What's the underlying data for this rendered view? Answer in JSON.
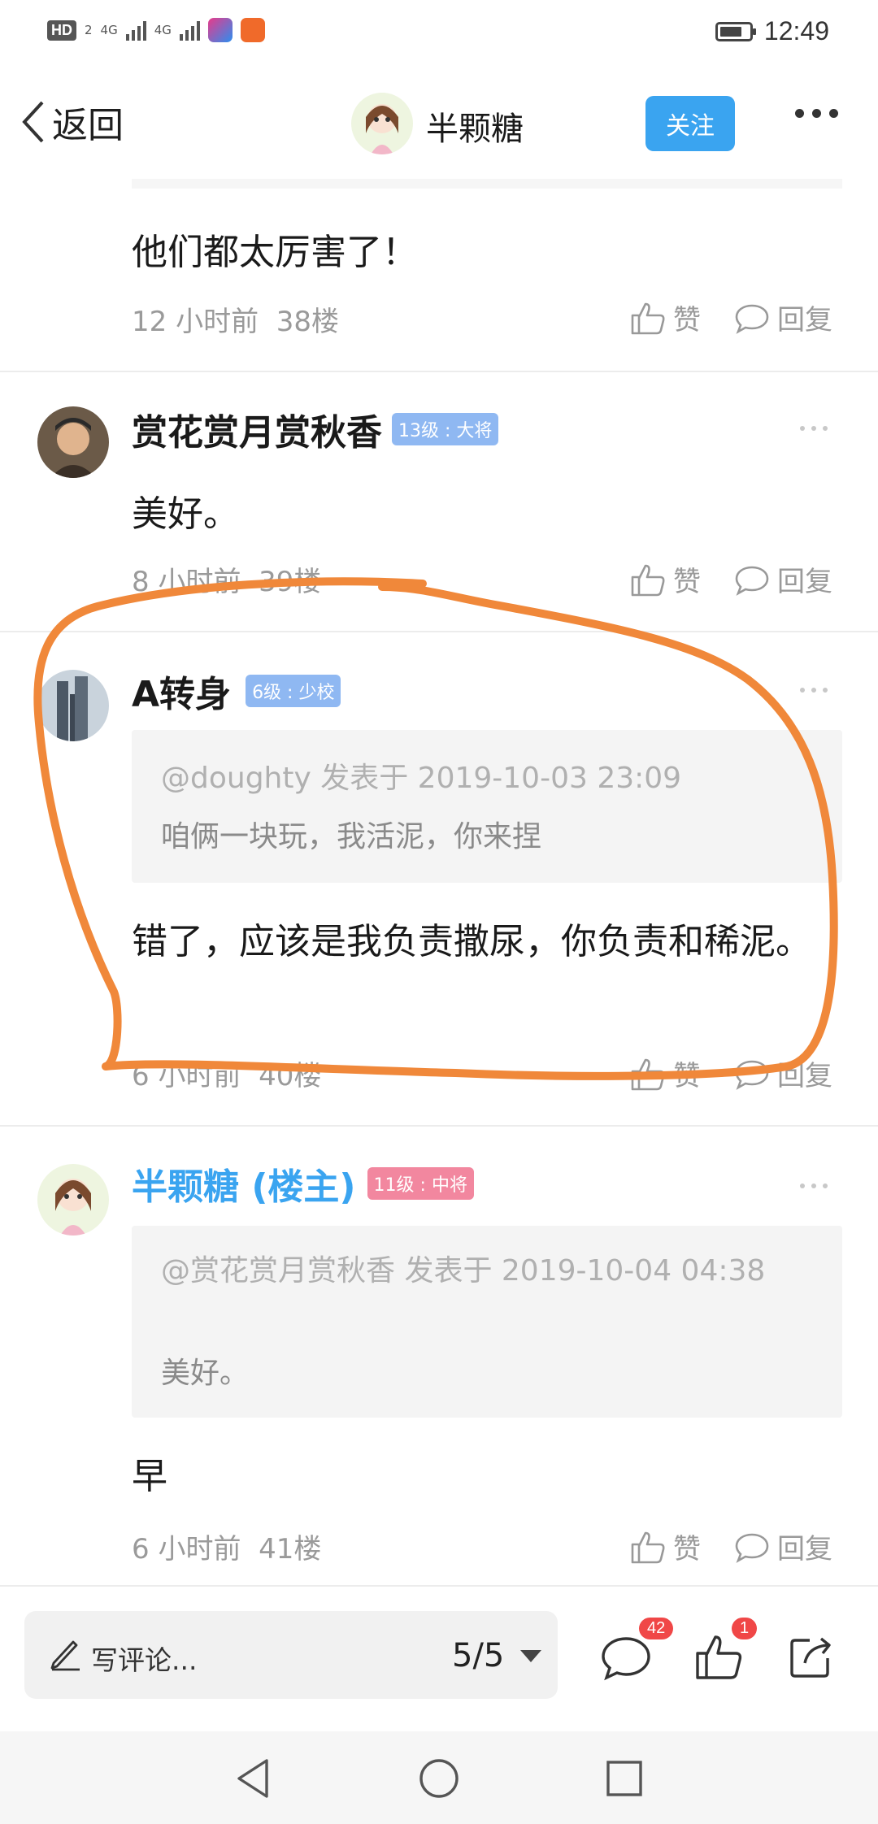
{
  "status_bar": {
    "hd": "HD",
    "hd_sub": "2",
    "net1": "4G",
    "net2": "4G",
    "time": "12:49"
  },
  "header": {
    "back_label": "返回",
    "title": "半颗糖",
    "follow_label": "关注"
  },
  "floors": [
    {
      "content": "他们都太厉害了！",
      "time": "12 小时前",
      "floor": "38楼",
      "like": "赞",
      "reply": "回复"
    },
    {
      "user": "赏花赏月赏秋香",
      "level": "13级 : 大将",
      "content": "美好。",
      "time": "8 小时前",
      "floor": "39楼",
      "like": "赞",
      "reply": "回复"
    },
    {
      "user": "A转身",
      "level": "6级 : 少校",
      "quote_head": "@doughty 发表于 2019-10-03 23:09",
      "quote_body": "咱俩一块玩，我活泥，你来捏",
      "content": "错了，应该是我负责撒尿，你负责和稀泥。",
      "time": "6 小时前",
      "floor": "40楼",
      "like": "赞",
      "reply": "回复"
    },
    {
      "user": "半颗糖 (楼主)",
      "level": "11级 : 中将",
      "quote_head": "@赏花赏月赏秋香 发表于 2019-10-04 04:38",
      "quote_body": "美好。",
      "content": "早",
      "time": "6 小时前",
      "floor": "41楼",
      "like": "赞",
      "reply": "回复"
    }
  ],
  "bottom_bar": {
    "comment_placeholder": "写评论...",
    "page": "5/5",
    "comment_count": "42",
    "like_count": "1"
  },
  "colors": {
    "accent_blue": "#3aa4f0",
    "op_name": "#3aa4f0",
    "level_blue": "#8fb8f2",
    "level_pink": "#f2879f",
    "annotation_orange": "#f0883a",
    "badge_red": "#f04747"
  }
}
